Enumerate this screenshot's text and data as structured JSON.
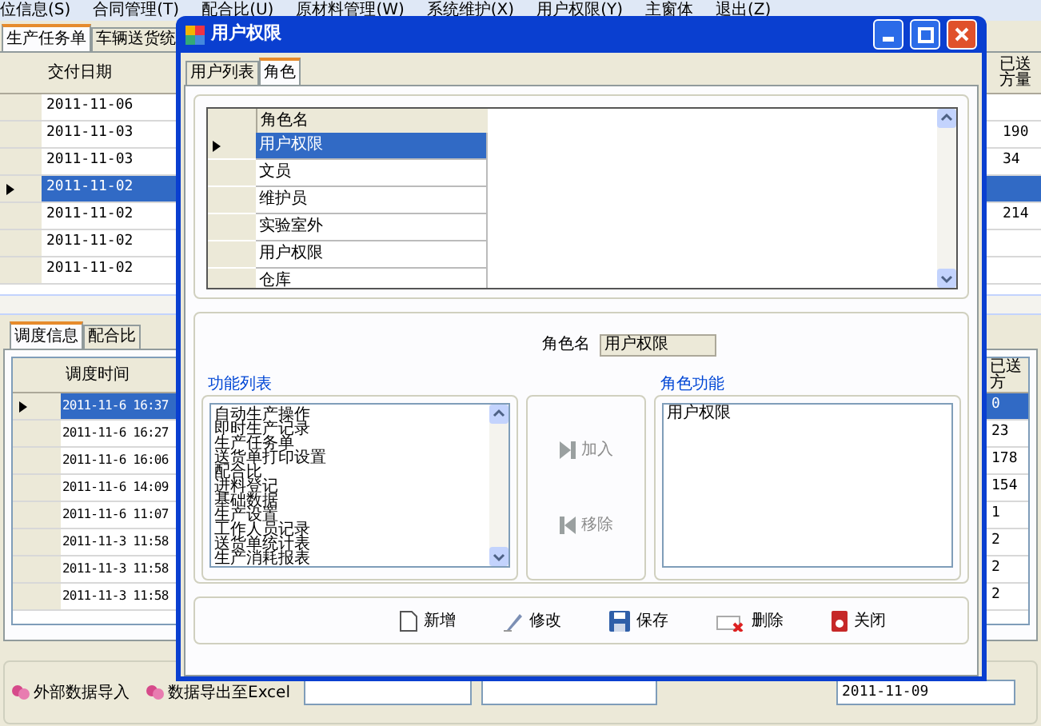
{
  "menu": [
    "位信息(S)",
    "合同管理(T)",
    "配合比(U)",
    "原材料管理(W)",
    "系统维护(X)",
    "用户权限(Y)",
    "主窗体",
    "退出(Z)"
  ],
  "main_tabs": [
    {
      "label": "生产任务单",
      "selected": true
    },
    {
      "label": "车辆送货统",
      "selected": false
    }
  ],
  "top_grid": {
    "columns": [
      "交付日期",
      "已送方量"
    ],
    "rows": [
      {
        "date": "2011-11-06",
        "delivered": "",
        "selected": false
      },
      {
        "date": "2011-11-03",
        "delivered": "190",
        "selected": false
      },
      {
        "date": "2011-11-03",
        "delivered": "34",
        "selected": false
      },
      {
        "date": "2011-11-02",
        "delivered": "",
        "selected": true
      },
      {
        "date": "2011-11-02",
        "delivered": "214",
        "selected": false
      },
      {
        "date": "2011-11-02",
        "delivered": "",
        "selected": false
      },
      {
        "date": "2011-11-02",
        "delivered": "",
        "selected": false
      }
    ]
  },
  "bottom_tabs": [
    {
      "label": "调度信息",
      "selected": true
    },
    {
      "label": "配合比",
      "selected": false
    }
  ],
  "bottom_grid": {
    "columns": [
      "调度时间",
      "已送方"
    ],
    "rows": [
      {
        "time": "2011-11-6 16:37",
        "delivered": "0",
        "selected": true
      },
      {
        "time": "2011-11-6 16:27",
        "delivered": "23",
        "selected": false
      },
      {
        "time": "2011-11-6 16:06",
        "delivered": "178",
        "selected": false
      },
      {
        "time": "2011-11-6 14:09",
        "delivered": "154",
        "selected": false
      },
      {
        "time": "2011-11-6 11:07",
        "delivered": "1",
        "selected": false
      },
      {
        "time": "2011-11-3 11:58",
        "delivered": "2",
        "selected": false
      },
      {
        "time": "2011-11-3 11:58",
        "delivered": "2",
        "selected": false
      },
      {
        "time": "2011-11-3 11:58",
        "delivered": "2",
        "selected": false
      }
    ]
  },
  "toolbar": {
    "import_button": "外部数据导入",
    "export_button": "数据导出至Excel",
    "date_value": "2011-11-09"
  },
  "dialog": {
    "title": "用户权限",
    "tabs": [
      {
        "label": "用户列表",
        "selected": false
      },
      {
        "label": "角色",
        "selected": true
      }
    ],
    "roles": {
      "column": "角色名",
      "rows": [
        {
          "name": "用户权限",
          "selected": true
        },
        {
          "name": "文员",
          "selected": false
        },
        {
          "name": "维护员",
          "selected": false
        },
        {
          "name": "实验室外",
          "selected": false
        },
        {
          "name": "用户权限",
          "selected": false
        },
        {
          "name": "仓库",
          "selected": false
        }
      ]
    },
    "role_name_label": "角色名",
    "role_name_value": "用户权限",
    "function_list": {
      "title": "功能列表",
      "items": [
        "自动生产操作",
        "即时生产记录",
        "生产任务单",
        "送货单打印设置",
        "配合比",
        "进料登记",
        "基础数据",
        "生产设置",
        "工作人员记录",
        "送货单统计表",
        "生产消耗报表"
      ]
    },
    "add_button": {
      "label": "加入",
      "disabled": true
    },
    "remove_button": {
      "label": "移除",
      "disabled": true
    },
    "role_functions": {
      "title": "角色功能",
      "items": [
        "用户权限"
      ]
    },
    "actions": [
      {
        "kind": "new",
        "label": "新增"
      },
      {
        "kind": "edit",
        "label": "修改"
      },
      {
        "kind": "save",
        "label": "保存"
      },
      {
        "kind": "delete",
        "label": "删除"
      },
      {
        "kind": "close",
        "label": "关闭"
      }
    ]
  }
}
